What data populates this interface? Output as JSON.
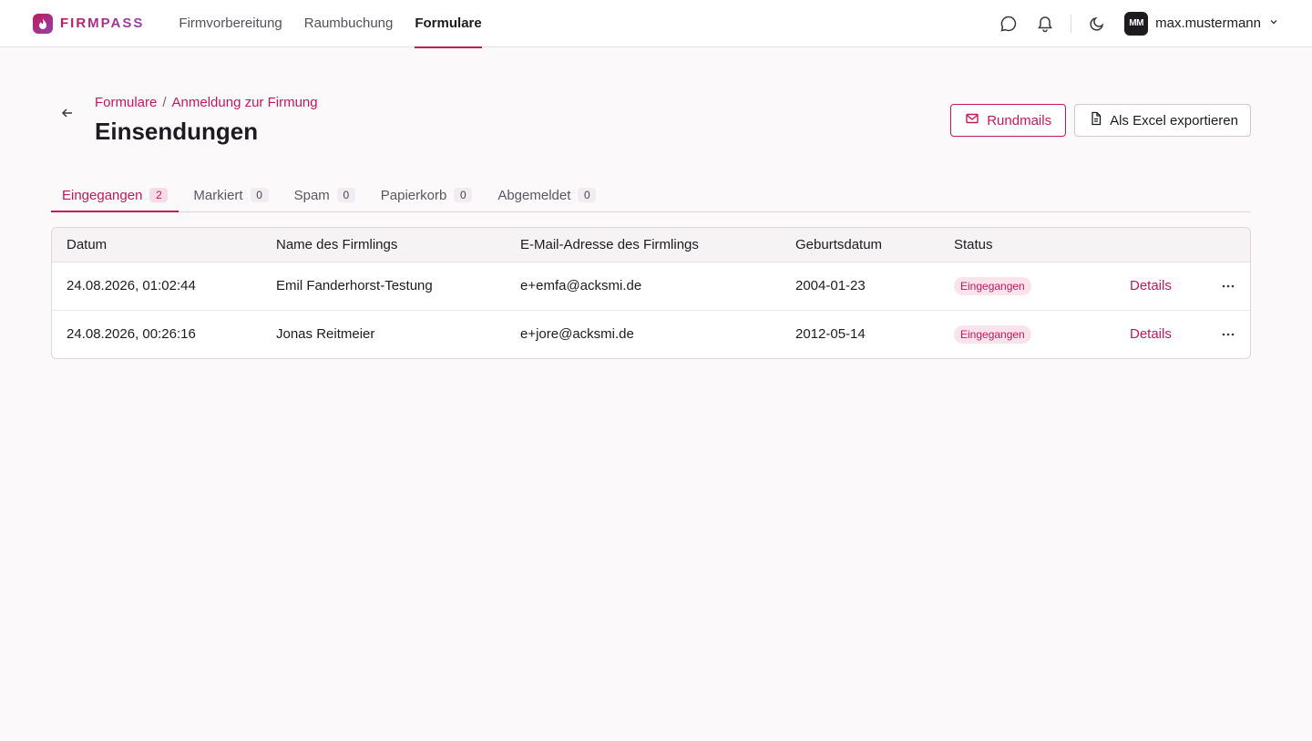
{
  "brand": {
    "name": "FIRMPASS"
  },
  "nav": {
    "items": [
      {
        "label": "Firmvorbereitung",
        "active": false
      },
      {
        "label": "Raumbuchung",
        "active": false
      },
      {
        "label": "Formulare",
        "active": true
      }
    ]
  },
  "user": {
    "initials": "MM",
    "name": "max.mustermann"
  },
  "breadcrumb": {
    "parent": "Formulare",
    "separator": "/",
    "current": "Anmeldung zur Firmung"
  },
  "page": {
    "title": "Einsendungen"
  },
  "actions": {
    "mail_label": "Rundmails",
    "export_label": "Als Excel exportieren"
  },
  "tabs": [
    {
      "label": "Eingegangen",
      "count": "2",
      "active": true
    },
    {
      "label": "Markiert",
      "count": "0",
      "active": false
    },
    {
      "label": "Spam",
      "count": "0",
      "active": false
    },
    {
      "label": "Papierkorb",
      "count": "0",
      "active": false
    },
    {
      "label": "Abgemeldet",
      "count": "0",
      "active": false
    }
  ],
  "table": {
    "headers": [
      "Datum",
      "Name des Firmlings",
      "E-Mail-Adresse des Firmlings",
      "Geburtsdatum",
      "Status"
    ],
    "rows": [
      {
        "date": "24.08.2026, 01:02:44",
        "name": "Emil Fanderhorst-Testung",
        "email": "e+emfa@acksmi.de",
        "birth": "2004-01-23",
        "status": "Eingegangen",
        "details": "Details"
      },
      {
        "date": "24.08.2026, 00:26:16",
        "name": "Jonas Reitmeier",
        "email": "e+jore@acksmi.de",
        "birth": "2012-05-14",
        "status": "Eingegangen",
        "details": "Details"
      }
    ]
  },
  "colors": {
    "accent": "#c2185b",
    "accent_soft": "#fbe3ec",
    "background": "#fcf9fb"
  }
}
